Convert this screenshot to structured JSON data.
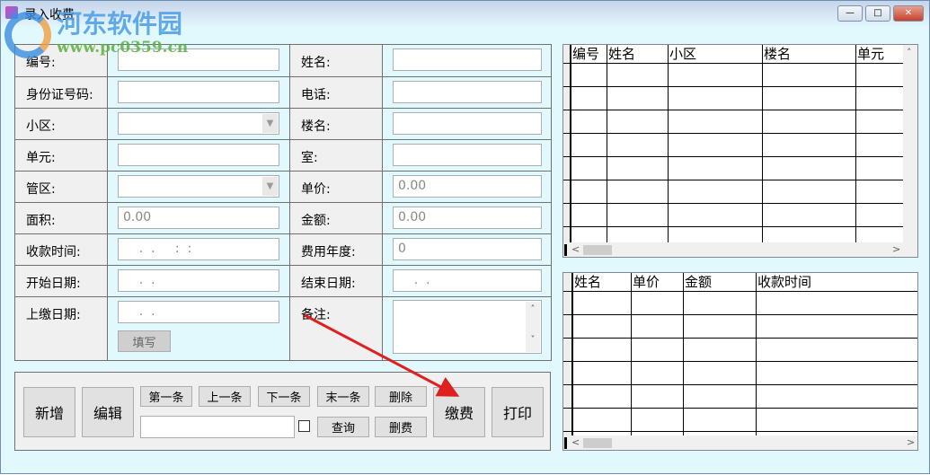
{
  "window": {
    "title": "录入收费",
    "min": "—",
    "max": "□",
    "close": "✕"
  },
  "watermark": {
    "name": "河东软件园",
    "url": "www.pc0359.cn"
  },
  "form": {
    "rows": [
      {
        "l1": "编号:",
        "v1": "",
        "l2": "姓名:",
        "v2": ""
      },
      {
        "l1": "身份证号码:",
        "v1": "",
        "l2": "电话:",
        "v2": ""
      },
      {
        "l1": "小区:",
        "v1": "",
        "l2": "楼名:",
        "v2": ""
      },
      {
        "l1": "单元:",
        "v1": "",
        "l2": "室:",
        "v2": ""
      },
      {
        "l1": "管区:",
        "v1": "",
        "l2": "单价:",
        "v2": "0.00"
      },
      {
        "l1": "面积:",
        "v1": "0.00",
        "l2": "金额:",
        "v2": "0.00"
      },
      {
        "l1": "收款时间:",
        "v1": "    .  .     :  :",
        "l2": "费用年度:",
        "v2": "0"
      },
      {
        "l1": "开始日期:",
        "v1": "    .  .",
        "l2": "结束日期:",
        "v2": "    .  ."
      },
      {
        "l1": "上缴日期:",
        "v1": "    .  .",
        "l2": "备注:",
        "v2": ""
      }
    ],
    "fill_button": "填写"
  },
  "actions": {
    "add": "新增",
    "edit": "编辑",
    "first": "第一条",
    "prev": "上一条",
    "next": "下一条",
    "last": "末一条",
    "delete": "删除",
    "query": "查询",
    "delete_fee": "删费",
    "pay": "缴费",
    "print": "打印",
    "search_value": ""
  },
  "grid1": {
    "columns": [
      "编号",
      "姓名",
      "小区",
      "楼名",
      "单元"
    ]
  },
  "grid2": {
    "columns": [
      "姓名",
      "单价",
      "金额",
      "收款时间"
    ]
  },
  "colors": {
    "background": "#e1f8fd",
    "arrow": "#e02020"
  }
}
